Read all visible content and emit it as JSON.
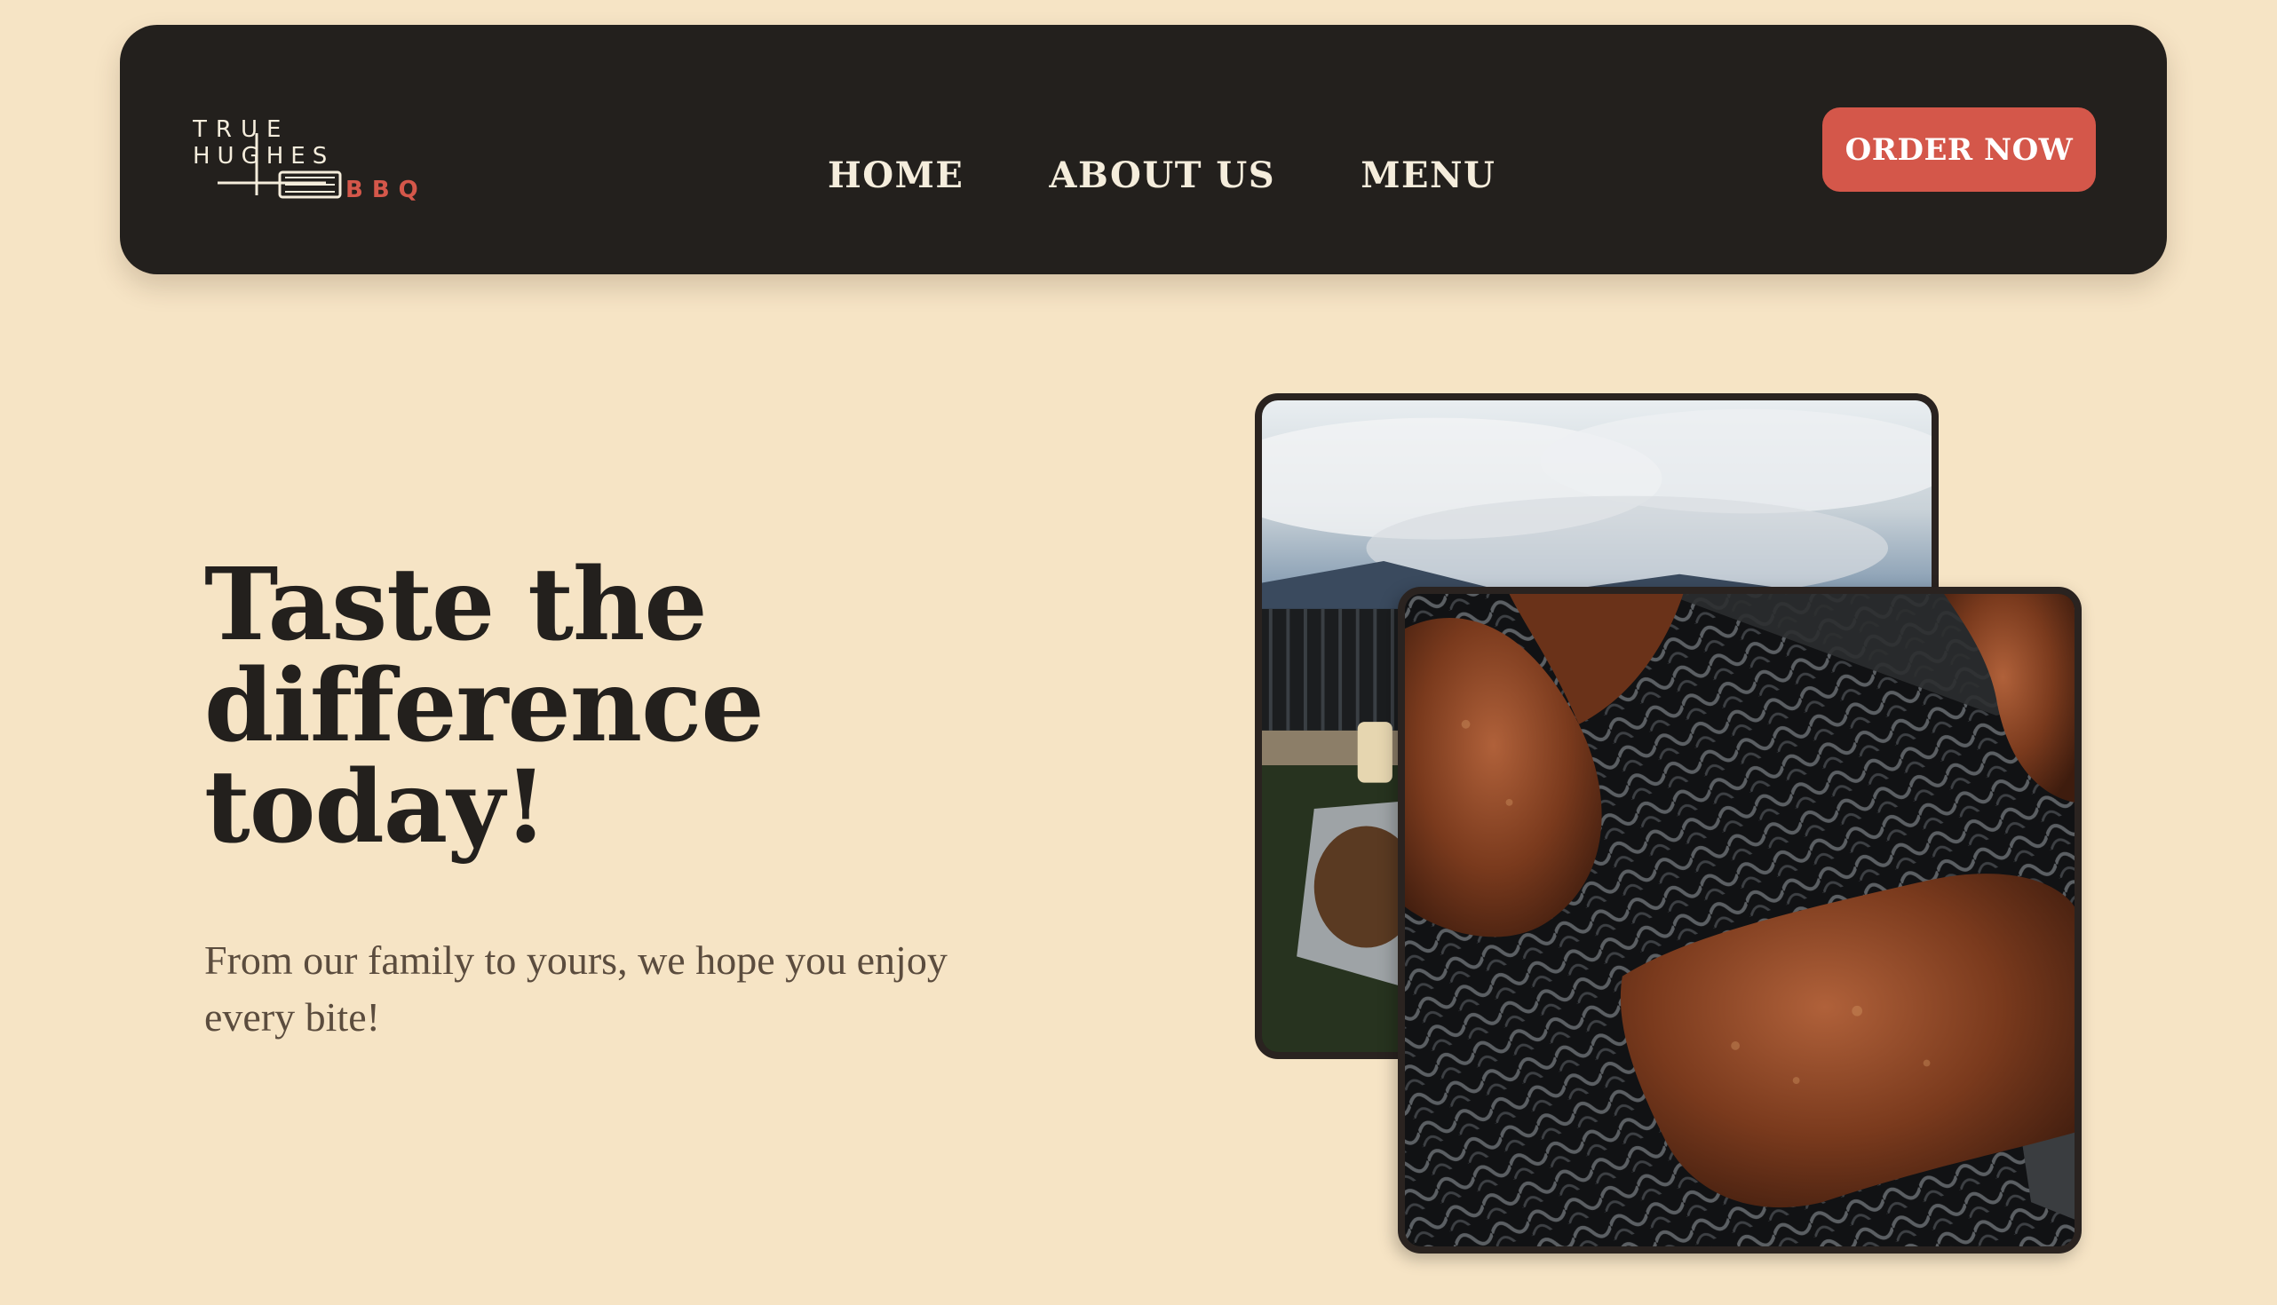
{
  "brand": {
    "logo_line1": "TRUE",
    "logo_line2": "HUGHES",
    "logo_line3": "BBQ",
    "logo_alt": "True Hughes BBQ"
  },
  "nav": {
    "items": [
      {
        "label": "HOME"
      },
      {
        "label": "ABOUT US"
      },
      {
        "label": "MENU"
      }
    ],
    "cta_label": "ORDER NOW"
  },
  "hero": {
    "title_line1": "Taste the",
    "title_line2": "difference",
    "title_line3": "today!",
    "subtitle": "From our family to yours, we hope you enjoy every bite!"
  },
  "images": {
    "back_alt": "BBQ tray outdoors under cloudy sky",
    "front_alt": "Ribs smoking on grill grate"
  },
  "colors": {
    "background": "#f6e4c5",
    "navbar": "#23201d",
    "accent": "#d4574a",
    "nav_text": "#f5eddc",
    "heading": "#23201d",
    "body_text": "#5b4c3e"
  }
}
